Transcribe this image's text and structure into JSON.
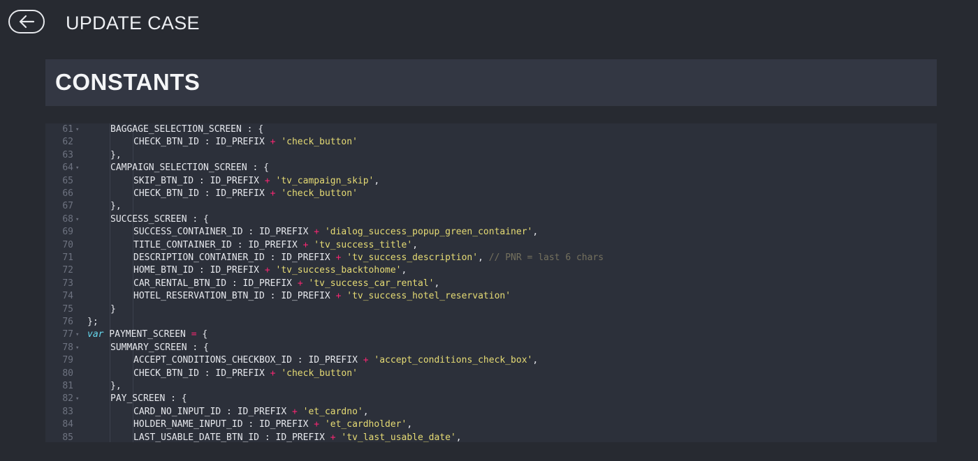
{
  "header": {
    "back_icon": "arrow-left-icon",
    "title": "UPDATE CASE"
  },
  "section": {
    "title": "CONSTANTS"
  },
  "editor": {
    "lines": [
      {
        "n": "61",
        "fold": true,
        "indent": 1,
        "tokens": [
          {
            "t": "tx",
            "v": "BAGGAGE_SELECTION_SCREEN : {"
          }
        ]
      },
      {
        "n": "62",
        "fold": false,
        "indent": 2,
        "tokens": [
          {
            "t": "tx",
            "v": "CHECK_BTN_ID : ID_PREFIX "
          },
          {
            "t": "op",
            "v": "+"
          },
          {
            "t": "tx",
            "v": " "
          },
          {
            "t": "str",
            "v": "'check_button'"
          }
        ]
      },
      {
        "n": "63",
        "fold": false,
        "indent": 1,
        "tokens": [
          {
            "t": "tx",
            "v": "},"
          }
        ]
      },
      {
        "n": "64",
        "fold": true,
        "indent": 1,
        "tokens": [
          {
            "t": "tx",
            "v": "CAMPAIGN_SELECTION_SCREEN : {"
          }
        ]
      },
      {
        "n": "65",
        "fold": false,
        "indent": 2,
        "tokens": [
          {
            "t": "tx",
            "v": "SKIP_BTN_ID : ID_PREFIX "
          },
          {
            "t": "op",
            "v": "+"
          },
          {
            "t": "tx",
            "v": " "
          },
          {
            "t": "str",
            "v": "'tv_campaign_skip'"
          },
          {
            "t": "tx",
            "v": ","
          }
        ]
      },
      {
        "n": "66",
        "fold": false,
        "indent": 2,
        "tokens": [
          {
            "t": "tx",
            "v": "CHECK_BTN_ID : ID_PREFIX "
          },
          {
            "t": "op",
            "v": "+"
          },
          {
            "t": "tx",
            "v": " "
          },
          {
            "t": "str",
            "v": "'check_button'"
          }
        ]
      },
      {
        "n": "67",
        "fold": false,
        "indent": 1,
        "tokens": [
          {
            "t": "tx",
            "v": "},"
          }
        ]
      },
      {
        "n": "68",
        "fold": true,
        "indent": 1,
        "tokens": [
          {
            "t": "tx",
            "v": "SUCCESS_SCREEN : {"
          }
        ]
      },
      {
        "n": "69",
        "fold": false,
        "indent": 2,
        "tokens": [
          {
            "t": "tx",
            "v": "SUCCESS_CONTAINER_ID : ID_PREFIX "
          },
          {
            "t": "op",
            "v": "+"
          },
          {
            "t": "tx",
            "v": " "
          },
          {
            "t": "str",
            "v": "'dialog_success_popup_green_container'"
          },
          {
            "t": "tx",
            "v": ","
          }
        ]
      },
      {
        "n": "70",
        "fold": false,
        "indent": 2,
        "tokens": [
          {
            "t": "tx",
            "v": "TITLE_CONTAINER_ID : ID_PREFIX "
          },
          {
            "t": "op",
            "v": "+"
          },
          {
            "t": "tx",
            "v": " "
          },
          {
            "t": "str",
            "v": "'tv_success_title'"
          },
          {
            "t": "tx",
            "v": ","
          }
        ]
      },
      {
        "n": "71",
        "fold": false,
        "indent": 2,
        "tokens": [
          {
            "t": "tx",
            "v": "DESCRIPTION_CONTAINER_ID : ID_PREFIX "
          },
          {
            "t": "op",
            "v": "+"
          },
          {
            "t": "tx",
            "v": " "
          },
          {
            "t": "str",
            "v": "'tv_success_description'"
          },
          {
            "t": "tx",
            "v": ", "
          },
          {
            "t": "cm",
            "v": "// PNR = last 6 chars"
          }
        ]
      },
      {
        "n": "72",
        "fold": false,
        "indent": 2,
        "tokens": [
          {
            "t": "tx",
            "v": "HOME_BTN_ID : ID_PREFIX "
          },
          {
            "t": "op",
            "v": "+"
          },
          {
            "t": "tx",
            "v": " "
          },
          {
            "t": "str",
            "v": "'tv_success_backtohome'"
          },
          {
            "t": "tx",
            "v": ","
          }
        ]
      },
      {
        "n": "73",
        "fold": false,
        "indent": 2,
        "tokens": [
          {
            "t": "tx",
            "v": "CAR_RENTAL_BTN_ID : ID_PREFIX "
          },
          {
            "t": "op",
            "v": "+"
          },
          {
            "t": "tx",
            "v": " "
          },
          {
            "t": "str",
            "v": "'tv_success_car_rental'"
          },
          {
            "t": "tx",
            "v": ","
          }
        ]
      },
      {
        "n": "74",
        "fold": false,
        "indent": 2,
        "tokens": [
          {
            "t": "tx",
            "v": "HOTEL_RESERVATION_BTN_ID : ID_PREFIX "
          },
          {
            "t": "op",
            "v": "+"
          },
          {
            "t": "tx",
            "v": " "
          },
          {
            "t": "str",
            "v": "'tv_success_hotel_reservation'"
          }
        ]
      },
      {
        "n": "75",
        "fold": false,
        "indent": 1,
        "tokens": [
          {
            "t": "tx",
            "v": "}"
          }
        ]
      },
      {
        "n": "76",
        "fold": false,
        "indent": 0,
        "tokens": [
          {
            "t": "tx",
            "v": "};"
          }
        ]
      },
      {
        "n": "77",
        "fold": true,
        "indent": 0,
        "tokens": [
          {
            "t": "kw",
            "v": "var"
          },
          {
            "t": "tx",
            "v": " PAYMENT_SCREEN "
          },
          {
            "t": "op",
            "v": "="
          },
          {
            "t": "tx",
            "v": " {"
          }
        ]
      },
      {
        "n": "78",
        "fold": true,
        "indent": 1,
        "tokens": [
          {
            "t": "tx",
            "v": "SUMMARY_SCREEN : {"
          }
        ]
      },
      {
        "n": "79",
        "fold": false,
        "indent": 2,
        "tokens": [
          {
            "t": "tx",
            "v": "ACCEPT_CONDITIONS_CHECKBOX_ID : ID_PREFIX "
          },
          {
            "t": "op",
            "v": "+"
          },
          {
            "t": "tx",
            "v": " "
          },
          {
            "t": "str",
            "v": "'accept_conditions_check_box'"
          },
          {
            "t": "tx",
            "v": ","
          }
        ]
      },
      {
        "n": "80",
        "fold": false,
        "indent": 2,
        "tokens": [
          {
            "t": "tx",
            "v": "CHECK_BTN_ID : ID_PREFIX "
          },
          {
            "t": "op",
            "v": "+"
          },
          {
            "t": "tx",
            "v": " "
          },
          {
            "t": "str",
            "v": "'check_button'"
          }
        ]
      },
      {
        "n": "81",
        "fold": false,
        "indent": 1,
        "tokens": [
          {
            "t": "tx",
            "v": "},"
          }
        ]
      },
      {
        "n": "82",
        "fold": true,
        "indent": 1,
        "tokens": [
          {
            "t": "tx",
            "v": "PAY_SCREEN : {"
          }
        ]
      },
      {
        "n": "83",
        "fold": false,
        "indent": 2,
        "tokens": [
          {
            "t": "tx",
            "v": "CARD_NO_INPUT_ID : ID_PREFIX "
          },
          {
            "t": "op",
            "v": "+"
          },
          {
            "t": "tx",
            "v": " "
          },
          {
            "t": "str",
            "v": "'et_cardno'"
          },
          {
            "t": "tx",
            "v": ","
          }
        ]
      },
      {
        "n": "84",
        "fold": false,
        "indent": 2,
        "tokens": [
          {
            "t": "tx",
            "v": "HOLDER_NAME_INPUT_ID : ID_PREFIX "
          },
          {
            "t": "op",
            "v": "+"
          },
          {
            "t": "tx",
            "v": " "
          },
          {
            "t": "str",
            "v": "'et_cardholder'"
          },
          {
            "t": "tx",
            "v": ","
          }
        ]
      },
      {
        "n": "85",
        "fold": false,
        "indent": 2,
        "tokens": [
          {
            "t": "tx",
            "v": "LAST_USABLE_DATE_BTN_ID : ID_PREFIX "
          },
          {
            "t": "op",
            "v": "+"
          },
          {
            "t": "tx",
            "v": " "
          },
          {
            "t": "str",
            "v": "'tv_last_usable_date'"
          },
          {
            "t": "tx",
            "v": ","
          }
        ]
      }
    ]
  },
  "colors": {
    "background": "#272a31",
    "header_panel": "#333743",
    "editor_bg": "#2c303a",
    "string": "#e6db74",
    "operator": "#f92672",
    "keyword": "#66d9ef",
    "comment": "#75715e"
  }
}
